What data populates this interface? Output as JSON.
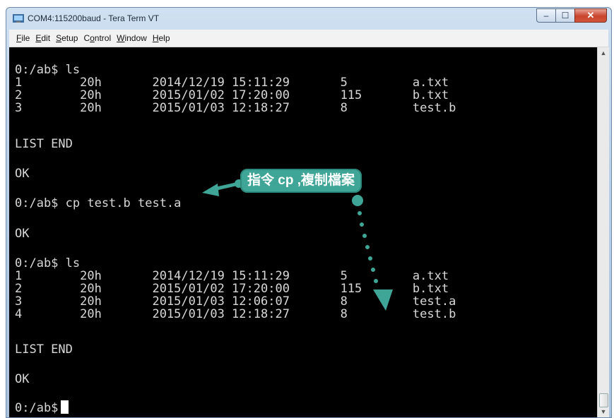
{
  "window": {
    "title": "COM4:115200baud - Tera Term VT",
    "controls": {
      "minimize": "–",
      "maximize": "☐",
      "close": "✕"
    }
  },
  "menu": [
    {
      "ul": "F",
      "rest": "ile"
    },
    {
      "ul": "E",
      "rest": "dit"
    },
    {
      "ul": "S",
      "rest": "etup"
    },
    {
      "pre": "C",
      "ul": "o",
      "rest": "ntrol"
    },
    {
      "ul": "W",
      "rest": "indow"
    },
    {
      "ul": "H",
      "rest": "elp"
    }
  ],
  "terminal": {
    "lines": [
      "0:/ab$ ls",
      "1        20h       2014/12/19 15:11:29       5         a.txt",
      "2        20h       2015/01/02 17:20:00       115       b.txt",
      "3        20h       2015/01/03 12:18:27       8         test.b",
      "LIST END",
      "OK",
      "0:/ab$ cp test.b test.a",
      "OK",
      "0:/ab$ ls",
      "1        20h       2014/12/19 15:11:29       5         a.txt",
      "2        20h       2015/01/02 17:20:00       115       b.txt",
      "3        20h       2015/01/03 12:06:07       8         test.a",
      "4        20h       2015/01/03 12:18:27       8         test.b",
      "LIST END",
      "OK",
      "0:/ab$"
    ]
  },
  "annotation": {
    "text": "指令 cp ,複制檔案",
    "color": "#3fa597"
  }
}
